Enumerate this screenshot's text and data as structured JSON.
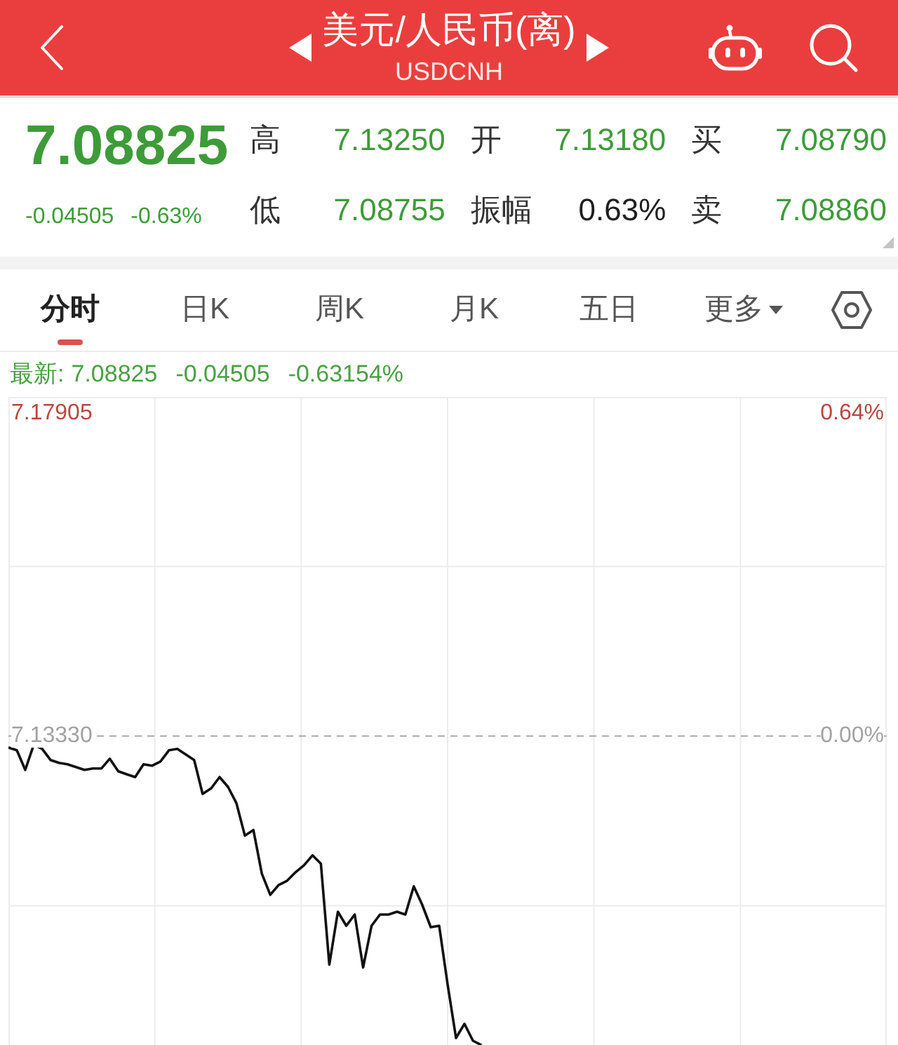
{
  "header": {
    "title": "美元/人民币(离)",
    "subtitle": "USDCNH"
  },
  "quote": {
    "price": "7.08825",
    "change": "-0.04505",
    "change_pct": "-0.63%",
    "stats": [
      {
        "label": "高",
        "value": "7.13250",
        "color": "#3e9b39"
      },
      {
        "label": "开",
        "value": "7.13180",
        "color": "#3e9b39"
      },
      {
        "label": "买",
        "value": "7.08790",
        "color": "#3e9b39"
      },
      {
        "label": "低",
        "value": "7.08755",
        "color": "#3e9b39"
      },
      {
        "label": "振幅",
        "value": "0.63%",
        "color": "#1f1f1f"
      },
      {
        "label": "卖",
        "value": "7.08860",
        "color": "#3e9b39"
      }
    ]
  },
  "tabs": [
    {
      "label": "分时",
      "selected": true,
      "kind": "tab"
    },
    {
      "label": "日K",
      "selected": false,
      "kind": "tab"
    },
    {
      "label": "周K",
      "selected": false,
      "kind": "tab"
    },
    {
      "label": "月K",
      "selected": false,
      "kind": "tab"
    },
    {
      "label": "五日",
      "selected": false,
      "kind": "tab"
    },
    {
      "label": "更多",
      "selected": false,
      "kind": "dropdown"
    }
  ],
  "latest": {
    "label": "最新:",
    "price": "7.08825",
    "change": "-0.04505",
    "change_pct": "-0.63154%"
  },
  "chart": {
    "percent_labels": [
      {
        "label": "0.64%",
        "color": "#b9473f"
      },
      {
        "label": "0.00%",
        "color": "#a3a3a3"
      }
    ],
    "chart_data": {
      "type": "line",
      "grid": true,
      "yticks": [
        {
          "value": 7.17905,
          "label": "7.17905"
        },
        {
          "value": 7.1333,
          "label": "7.13330"
        }
      ],
      "ylim": [
        7.0895,
        7.1814
      ],
      "ref_lines": [
        {
          "axis": "y",
          "value": 7.1333
        }
      ],
      "categories": [
        null,
        null,
        null,
        null,
        null,
        null,
        null,
        null,
        null,
        null,
        null,
        null,
        null,
        null,
        null,
        null,
        null,
        null,
        null,
        null,
        null,
        null,
        null,
        null,
        null,
        null,
        null,
        null,
        null,
        null,
        null,
        null,
        null,
        null,
        null,
        null,
        null,
        null,
        null,
        null,
        null,
        null,
        null,
        null,
        null,
        null,
        null,
        null,
        null,
        null,
        null,
        null,
        null,
        null,
        null,
        null,
        null,
        null,
        null,
        null,
        null,
        null,
        null,
        null,
        null,
        null,
        null,
        null,
        null,
        null,
        null,
        null,
        null,
        null,
        null,
        null,
        null,
        null,
        null,
        null,
        null,
        null,
        null,
        null,
        null,
        null,
        null,
        null,
        null,
        null,
        null,
        null,
        null,
        null,
        null,
        null,
        null,
        null,
        null,
        null,
        null,
        null,
        null,
        null,
        null
      ],
      "values": [
        7.1317,
        7.1313,
        7.1285,
        7.1321,
        7.1315,
        7.1299,
        7.1295,
        7.1293,
        7.1289,
        7.1285,
        7.1287,
        7.1287,
        7.1301,
        7.1283,
        7.1279,
        7.1275,
        7.1293,
        7.1291,
        7.1297,
        7.1313,
        7.1315,
        7.1307,
        7.1299,
        7.1251,
        7.1259,
        7.1275,
        7.1261,
        7.1238,
        7.1192,
        7.12,
        7.1138,
        7.1108,
        7.1122,
        7.1128,
        7.114,
        7.115,
        7.1164,
        7.1152,
        7.1009,
        7.1084,
        7.1064,
        7.108,
        7.1005,
        7.1064,
        7.108,
        7.108,
        7.1084,
        7.108,
        7.112,
        7.1094,
        7.1062,
        7.1064,
        7.0981,
        7.0905,
        7.0925,
        7.0901,
        7.0895,
        null,
        null,
        null,
        null,
        null,
        null,
        null,
        null,
        null,
        null,
        null,
        null,
        null,
        null,
        null,
        null,
        null,
        null,
        null,
        null,
        null,
        null,
        null,
        null,
        null,
        null,
        null,
        null,
        null,
        null,
        null,
        null,
        null,
        null,
        null,
        null,
        null,
        null,
        null,
        null,
        null,
        null,
        null,
        null,
        null,
        null,
        null,
        null
      ]
    }
  }
}
